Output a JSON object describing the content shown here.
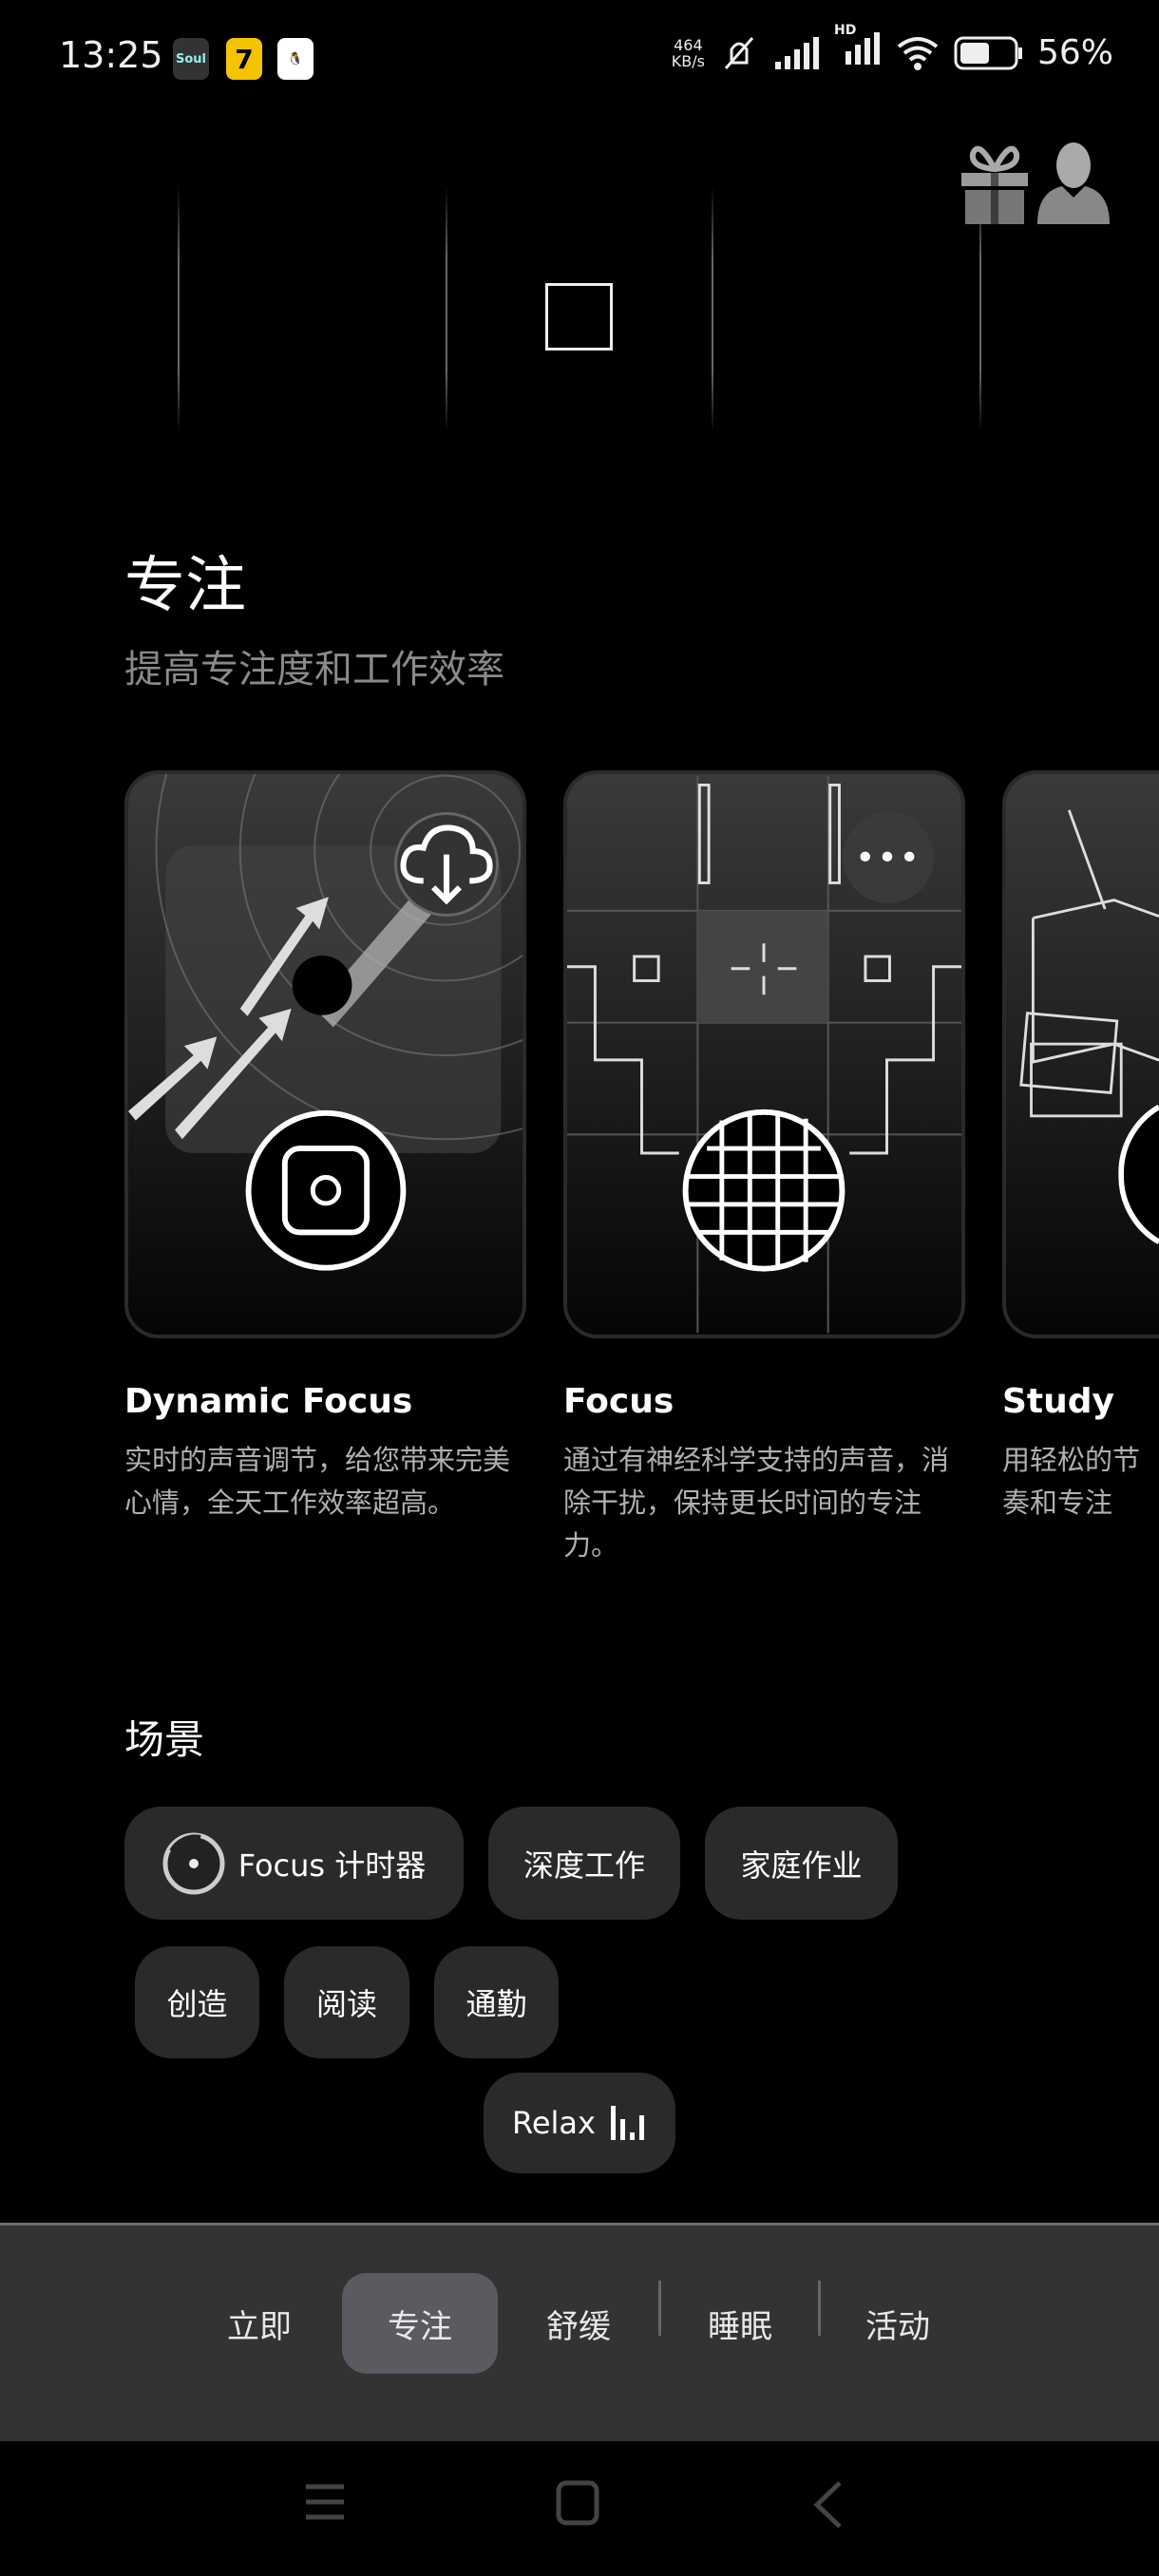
{
  "status_bar": {
    "time": "13:25",
    "apps": [
      "Soul",
      "7",
      "QQ"
    ],
    "net_speed_value": "464",
    "net_speed_unit": "KB/s",
    "network": "HD",
    "battery": "56%",
    "battery_level": 0.56
  },
  "header": {
    "icons": [
      "gift-icon",
      "profile-icon"
    ]
  },
  "page": {
    "title": "专注",
    "subtitle": "提高专注度和工作效率"
  },
  "cards": [
    {
      "title": "Dynamic Focus",
      "desc": "实时的声音调节，给您带来完美心情，全天工作效率超高。",
      "action_icon": "cloud-download-icon"
    },
    {
      "title": "Focus",
      "desc": "通过有神经科学支持的声音，消除干扰，保持更长时间的专注力。",
      "action_icon": "more-icon"
    },
    {
      "title": "Study",
      "desc": "用轻松的节奏和专注"
    }
  ],
  "scenes": {
    "title": "场景",
    "chips": [
      "Focus 计时器",
      "深度工作",
      "家庭作业",
      "创造",
      "阅读",
      "通勤",
      "Relax"
    ]
  },
  "bottom_nav": {
    "tabs": [
      "立即",
      "专注",
      "舒缓",
      "睡眠",
      "活动"
    ],
    "selected": "专注"
  },
  "colors": {
    "background": "#000000",
    "chip": "#2a2a2a",
    "nav_bar": "#333333",
    "selected_tab": "#5a5a60"
  }
}
